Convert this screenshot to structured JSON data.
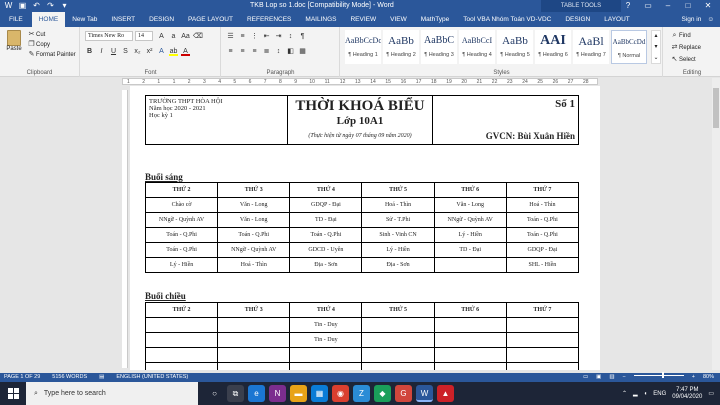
{
  "window": {
    "title": "TKB Lop so 1.doc [Compatibility Mode] - Word",
    "table_tools": "TABLE TOOLS"
  },
  "tabs": [
    "FILE",
    "HOME",
    "New Tab",
    "INSERT",
    "DESIGN",
    "PAGE LAYOUT",
    "REFERENCES",
    "MAILINGS",
    "REVIEW",
    "VIEW",
    "MathType",
    "Tool VBA Nhóm Toán VD-VDC",
    "DESIGN",
    "LAYOUT"
  ],
  "account": {
    "sign_in": "Sign in"
  },
  "clipboard": {
    "paste": "Paste",
    "cut": "Cut",
    "copy": "Copy",
    "format_painter": "Format Painter",
    "label": "Clipboard"
  },
  "font": {
    "name": "Times New Ro",
    "size": "14",
    "label": "Font"
  },
  "paragraph": {
    "label": "Paragraph"
  },
  "styles": {
    "label": "Styles",
    "items": [
      {
        "sample": "AaBbCcDc",
        "name": "¶ Heading 1"
      },
      {
        "sample": "AaBb",
        "name": "¶ Heading 2"
      },
      {
        "sample": "AaBbC",
        "name": "¶ Heading 3"
      },
      {
        "sample": "AaBbCcI",
        "name": "¶ Heading 4"
      },
      {
        "sample": "AaBb",
        "name": "¶ Heading 5"
      },
      {
        "sample": "AAI",
        "name": "¶ Heading 6"
      },
      {
        "sample": "AaBl",
        "name": "¶ Heading 7"
      },
      {
        "sample": "AaBbCcDd",
        "name": "¶ Normal"
      }
    ]
  },
  "editing": {
    "find": "Find",
    "replace": "Replace",
    "select": "Select",
    "label": "Editing"
  },
  "ruler": {
    "numbers": [
      "1",
      "2",
      "1",
      "1",
      "2",
      "3",
      "4",
      "5",
      "6",
      "7",
      "8",
      "9",
      "10",
      "11",
      "12",
      "13",
      "14",
      "15",
      "16",
      "17",
      "18",
      "19",
      "20",
      "21",
      "22",
      "23",
      "24",
      "25",
      "26",
      "27",
      "28"
    ]
  },
  "document": {
    "school": "TRƯỜNG THPT HÒA HỘI",
    "year": "Năm học 2020 - 2021",
    "term": "Học kỳ 1",
    "title": "THỜI KHOÁ BIỂU",
    "class": "Lớp 10A1",
    "apply_date": "(Thực hiện từ ngày 07 tháng 09 năm 2020)",
    "number": "Số 1",
    "gvcn": "GVCN: Bùi Xuân Hiền",
    "morning_label": "Buổi sáng",
    "afternoon_label": "Buổi chiều",
    "days": [
      "THỨ 2",
      "THỨ 3",
      "THỨ 4",
      "THỨ 5",
      "THỨ 6",
      "THỨ 7"
    ],
    "morning": [
      [
        "Chào cờ",
        "Văn - Long",
        "GDQP - Đại",
        "Hoá - Thìn",
        "Văn - Long",
        "Hoá - Thìn"
      ],
      [
        "NNgữ - Quỳnh AV",
        "Văn - Long",
        "TD - Đại",
        "Sử - T.Phi",
        "NNgữ - Quỳnh AV",
        "Toán - Q.Phi"
      ],
      [
        "Toán - Q.Phi",
        "Toán - Q.Phi",
        "Toán - Q.Phi",
        "Sinh - Vinh CN",
        "Lý - Hiền",
        "Toán - Q.Phi"
      ],
      [
        "Toán - Q.Phi",
        "NNgữ - Quỳnh AV",
        "GDCD - Uyên",
        "Lý - Hiền",
        "TD - Đại",
        "GDQP - Đại"
      ],
      [
        "Lý - Hiền",
        "Hoá - Thìn",
        "Địa - Sơn",
        "Địa - Sơn",
        "",
        "SHL - Hiền"
      ]
    ],
    "afternoon": [
      [
        "",
        "",
        "Tin - Duy",
        "",
        "",
        ""
      ],
      [
        "",
        "",
        "Tin - Duy",
        "",
        "",
        ""
      ],
      [
        "",
        "",
        "",
        "",
        "",
        ""
      ],
      [
        "",
        "",
        "",
        "",
        "",
        ""
      ]
    ]
  },
  "status": {
    "page": "PAGE 1 OF 29",
    "words": "5156 WORDS",
    "language": "ENGLISH (UNITED STATES)",
    "zoom": "80%"
  },
  "taskbar": {
    "search_placeholder": "Type here to search",
    "time": "7:47 PM",
    "date": "09/04/2020",
    "lang": "ENG"
  }
}
